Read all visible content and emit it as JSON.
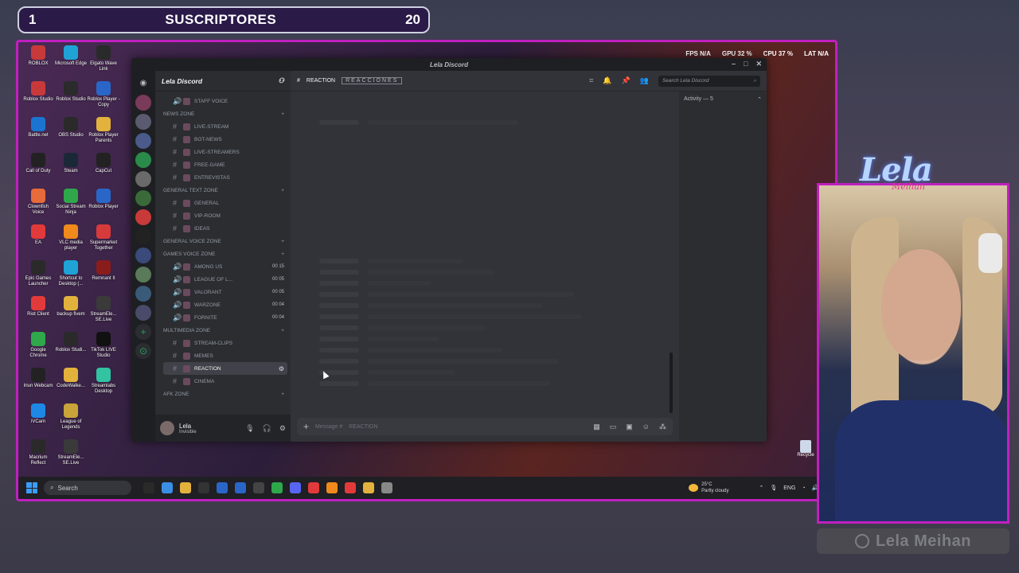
{
  "overlay": {
    "subs_index": "1",
    "subs_label": "SUSCRIPTORES",
    "subs_count": "20",
    "hud": [
      "FPS N/A",
      "GPU 32 %",
      "CPU 37 %",
      "LAT N/A"
    ],
    "cam_logo": "Lela",
    "cam_sub": "Meihan",
    "name_plate": "Lela Meihan"
  },
  "desktop": {
    "icons": [
      {
        "label": "ROBLOX",
        "color": "#c83a3a"
      },
      {
        "label": "Microsoft Edge",
        "color": "#1fa3d6"
      },
      {
        "label": "Elgato Wave Link",
        "color": "#2a2a2a"
      },
      {
        "label": "Roblox Studio",
        "color": "#c83a3a"
      },
      {
        "label": "Roblox Studio",
        "color": "#2b2b2b"
      },
      {
        "label": "Roblox Player - Copy",
        "color": "#2a66c8"
      },
      {
        "label": "Battle.net",
        "color": "#1b75d0"
      },
      {
        "label": "OBS Studio",
        "color": "#2a2a2a"
      },
      {
        "label": "Roblox Player Parents",
        "color": "#e3b23c"
      },
      {
        "label": "Call of Duty",
        "color": "#222"
      },
      {
        "label": "Steam",
        "color": "#1b2838"
      },
      {
        "label": "CapCut",
        "color": "#222"
      },
      {
        "label": "Clownfish Voice",
        "color": "#e76b3a"
      },
      {
        "label": "Social Stream Ninja",
        "color": "#2ea84b"
      },
      {
        "label": "Roblox Player",
        "color": "#2a66c8"
      },
      {
        "label": "EA",
        "color": "#e23a3a"
      },
      {
        "label": "VLC media player",
        "color": "#f08a1c"
      },
      {
        "label": "Supermarket Together",
        "color": "#d63a3a"
      },
      {
        "label": "Epic Games Launcher",
        "color": "#2a2a2a"
      },
      {
        "label": "Shortcut to Desktop (...",
        "color": "#1fa3d6"
      },
      {
        "label": "Remnant II",
        "color": "#8a1c1c"
      },
      {
        "label": "Riot Client",
        "color": "#e23a3a"
      },
      {
        "label": "backup fivem",
        "color": "#e3b23c"
      },
      {
        "label": "StreamEle... SE.Live",
        "color": "#3a3a3a"
      },
      {
        "label": "Google Chrome",
        "color": "#2ea84b"
      },
      {
        "label": "Roblox Studi...",
        "color": "#2a2a2a"
      },
      {
        "label": "TikTok LIVE Studio",
        "color": "#111"
      },
      {
        "label": "Iriun Webcam",
        "color": "#222"
      },
      {
        "label": "CodeWalke...",
        "color": "#e3b23c"
      },
      {
        "label": "Streamlabs Desktop",
        "color": "#31c3a2"
      },
      {
        "label": "iVCam",
        "color": "#1e88e5"
      },
      {
        "label": "League of Legends",
        "color": "#c8a43a"
      },
      {
        "label": "",
        "color": "transparent"
      },
      {
        "label": "Macrium Reflect",
        "color": "#2a2a2a"
      },
      {
        "label": "StreamEle... SE.Live",
        "color": "#3a3a3a"
      }
    ],
    "recycle": "Recycle",
    "taskbar": {
      "search": "Search",
      "apps": [
        "#2a2a2a",
        "#3b8ee6",
        "#e3b23c",
        "#333",
        "#2a66c8",
        "#2a66c8",
        "#444",
        "#2ea84b",
        "#5865f2",
        "#e23a3a",
        "#f08a1c",
        "#e23a3a",
        "#e3b23c",
        "#888"
      ],
      "weather_temp": "25°C",
      "weather_desc": "Partly cloudy",
      "lang": "ENG"
    }
  },
  "discord": {
    "title": "Lela Discord",
    "server_name": "Lela Discord",
    "channel_header": "REACTION",
    "channel_tag": "REACCIONES",
    "search_placeholder": "Search Lela Discord",
    "activity": "Activity — 5",
    "composer_placeholder": "Message #",
    "composer_channel": "REACTION",
    "user_name": "Lela",
    "user_status": "Invisible",
    "categories": [
      {
        "label": "",
        "channels": [
          {
            "name": "STAFF VOICE",
            "type": "voice",
            "count": ""
          }
        ]
      },
      {
        "label": "NEWS ZONE",
        "channels": [
          {
            "name": "LIVE-STREAM",
            "type": "text",
            "count": ""
          },
          {
            "name": "BOT-NEWS",
            "type": "text",
            "count": ""
          },
          {
            "name": "LIVE-STREAMERS",
            "type": "text",
            "count": ""
          },
          {
            "name": "FREE-GAME",
            "type": "text",
            "count": ""
          },
          {
            "name": "ENTREVISTAS",
            "type": "text",
            "count": ""
          }
        ]
      },
      {
        "label": "GENERAL TEXT ZONE",
        "channels": [
          {
            "name": "GENERAL",
            "type": "text",
            "count": ""
          },
          {
            "name": "VIP-ROOM",
            "type": "text",
            "count": ""
          },
          {
            "name": "IDEAS",
            "type": "text",
            "count": ""
          }
        ]
      },
      {
        "label": "GENERAL VOICE ZONE",
        "channels": []
      },
      {
        "label": "GAMES VOICE ZONE",
        "channels": [
          {
            "name": "AMONG US",
            "type": "voice",
            "count": "00 15"
          },
          {
            "name": "LEAGUE OF L...",
            "type": "voice",
            "count": "00 05"
          },
          {
            "name": "VALORANT",
            "type": "voice",
            "count": "00 05"
          },
          {
            "name": "WARZONE",
            "type": "voice",
            "count": "00 04"
          },
          {
            "name": "FORNITE",
            "type": "voice",
            "count": "00 04"
          }
        ]
      },
      {
        "label": "MULTIMEDIA ZONE",
        "channels": [
          {
            "name": "STREAM-CLIPS",
            "type": "text",
            "count": ""
          },
          {
            "name": "MEMES",
            "type": "text",
            "count": ""
          },
          {
            "name": "REACTION",
            "type": "text",
            "count": "",
            "active": true
          },
          {
            "name": "CINEMA",
            "type": "text",
            "count": ""
          }
        ]
      },
      {
        "label": "AFK ZONE",
        "channels": []
      }
    ]
  }
}
